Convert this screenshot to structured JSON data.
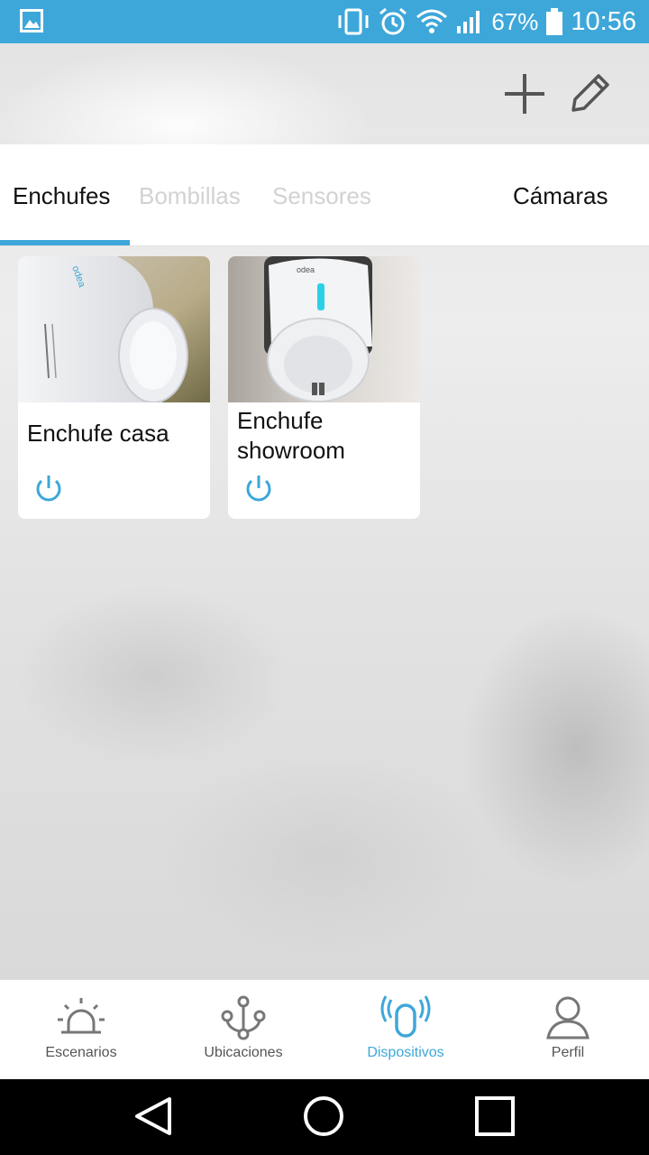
{
  "status_bar": {
    "battery_percent": "67%",
    "time": "10:56",
    "icons": [
      "gallery-icon",
      "vibrate-icon",
      "alarm-icon",
      "wifi-icon",
      "signal-icon",
      "battery-icon"
    ]
  },
  "toolbar": {
    "add_icon": "plus-icon",
    "edit_icon": "pencil-icon"
  },
  "tabs": [
    {
      "label": "Enchufes",
      "active": true
    },
    {
      "label": "Bombillas",
      "active": false
    },
    {
      "label": "Sensores",
      "active": false
    },
    {
      "label": "Cámaras",
      "active": false
    }
  ],
  "devices": [
    {
      "name": "Enchufe casa",
      "power_icon": "power-icon"
    },
    {
      "name": "Enchufe showroom",
      "power_icon": "power-icon"
    }
  ],
  "bottom_nav": [
    {
      "label": "Escenarios",
      "icon": "siren-icon",
      "active": false
    },
    {
      "label": "Ubicaciones",
      "icon": "network-icon",
      "active": false
    },
    {
      "label": "Dispositivos",
      "icon": "device-icon",
      "active": true
    },
    {
      "label": "Perfil",
      "icon": "profile-icon",
      "active": false
    }
  ],
  "colors": {
    "accent": "#3ea7d9",
    "tab_inactive": "#d2d2d2",
    "nav_inactive": "#555555"
  }
}
